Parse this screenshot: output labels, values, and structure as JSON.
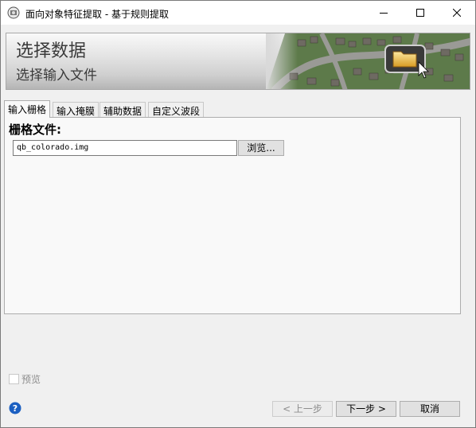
{
  "window": {
    "title": "面向对象特征提取 - 基于规则提取",
    "app_icon": "app-icon",
    "controls": {
      "minimize_icon": "minimize-icon",
      "maximize_icon": "maximize-icon",
      "close_icon": "close-icon"
    }
  },
  "banner": {
    "title": "选择数据",
    "subtitle": "选择输入文件",
    "image": "aerial-neighborhood-folder-illustration"
  },
  "tabs": [
    {
      "label": "输入栅格",
      "active": true
    },
    {
      "label": "输入掩膜",
      "active": false
    },
    {
      "label": "辅助数据",
      "active": false
    },
    {
      "label": "自定义波段",
      "active": false
    }
  ],
  "raster": {
    "label": "栅格文件:",
    "file_value": "qb_colorado.img",
    "browse_label": "浏览..."
  },
  "preview": {
    "label": "预览",
    "checked": false,
    "enabled": false
  },
  "footer": {
    "help_icon": "help-icon",
    "prev_label": "< 上一步",
    "next_label": "下一步 >",
    "cancel_label": "取消"
  },
  "colors": {
    "window_bg": "#f0f0f0",
    "panel_bg": "#f9f9f9",
    "help_blue": "#1b5fc1",
    "disabled_text": "#8d8d8d"
  }
}
